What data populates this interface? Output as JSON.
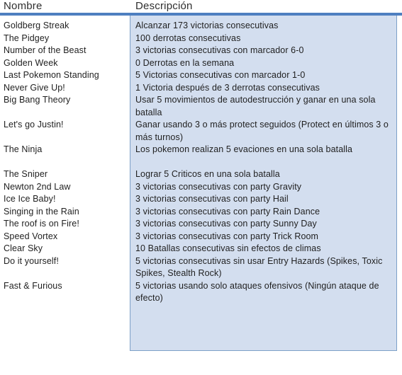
{
  "header": {
    "name_label": "Nombre",
    "description_label": "Descripción",
    "rule_color": "#4e7fc0"
  },
  "panel": {
    "fill_color": "#d3deef",
    "border_color": "#7da0c8"
  },
  "rows": [
    {
      "name": "Goldberg Streak",
      "description": "Alcanzar 173 victorias consecutivas",
      "lines": 1
    },
    {
      "name": "The Pidgey",
      "description": "100 derrotas consecutivas",
      "lines": 1
    },
    {
      "name": "Number of the Beast",
      "description": "3 victorias consecutivas con marcador 6-0",
      "lines": 1
    },
    {
      "name": "Golden Week",
      "description": "0 Derrotas en la semana",
      "lines": 1
    },
    {
      "name": "Last Pokemon Standing",
      "description": "5 Victorias consecutivas con marcador 1-0",
      "lines": 1
    },
    {
      "name": "Never Give Up!",
      "description": "1 Victoria después de 3 derrotas consecutivas",
      "lines": 1
    },
    {
      "name": "Big Bang Theory",
      "description": "Usar 5 movimientos de autodestrucción y ganar en una sola batalla",
      "lines": 2
    },
    {
      "name": "Let's go Justin!",
      "description": "Ganar usando 3 o más protect seguidos (Protect en últimos 3 o más turnos)",
      "lines": 2
    },
    {
      "name": "The Ninja",
      "description": "Los pokemon realizan 5 evaciones en una sola batalla",
      "lines": 2
    },
    {
      "name": "The Sniper",
      "description": "Lograr 5 Criticos en una sola batalla",
      "lines": 1
    },
    {
      "name": "Newton 2nd Law",
      "description": "3 victorias consecutivas con party Gravity",
      "lines": 1
    },
    {
      "name": "Ice Ice Baby!",
      "description": "3 victorias consecutivas con party Hail",
      "lines": 1
    },
    {
      "name": "Singing in the Rain",
      "description": "3 victorias consecutivas con party Rain Dance",
      "lines": 1
    },
    {
      "name": "The roof is on Fire!",
      "description": "3 victorias consecutivas con party Sunny Day",
      "lines": 1
    },
    {
      "name": "Speed Vortex",
      "description": "3 victorias consecutivas con party Trick Room",
      "lines": 1
    },
    {
      "name": "Clear Sky",
      "description": "10 Batallas consecutivas sin efectos de climas",
      "lines": 1
    },
    {
      "name": "Do it yourself!",
      "description": "5 victorias consecutivas sin usar Entry Hazards (Spikes, Toxic Spikes, Stealth Rock)",
      "lines": 2
    },
    {
      "name": "Fast & Furious",
      "description": "5 victorias usando solo ataques ofensivos (Ningún ataque de efecto)",
      "lines": 2
    }
  ]
}
